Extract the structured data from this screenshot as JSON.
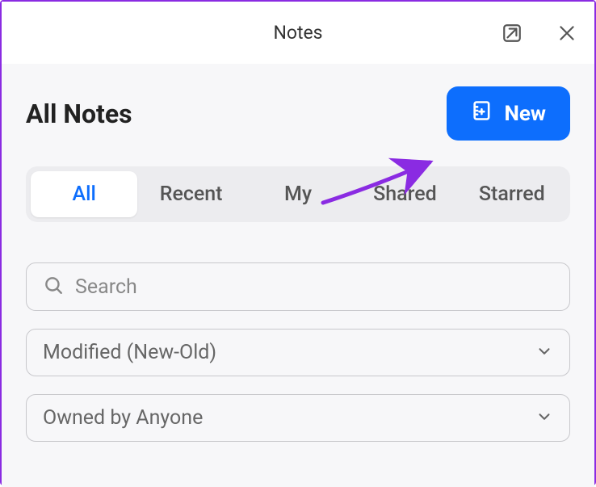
{
  "titlebar": {
    "title": "Notes"
  },
  "heading": "All Notes",
  "new_button": {
    "label": "New"
  },
  "tabs": [
    {
      "label": "All",
      "active": true
    },
    {
      "label": "Recent",
      "active": false
    },
    {
      "label": "My",
      "active": false
    },
    {
      "label": "Shared",
      "active": false
    },
    {
      "label": "Starred",
      "active": false
    }
  ],
  "search": {
    "placeholder": "Search"
  },
  "sort_dropdown": {
    "value": "Modified (New-Old)"
  },
  "owner_dropdown": {
    "value": "Owned by Anyone"
  },
  "colors": {
    "accent": "#0d6efd",
    "annotation": "#8a2be2"
  }
}
